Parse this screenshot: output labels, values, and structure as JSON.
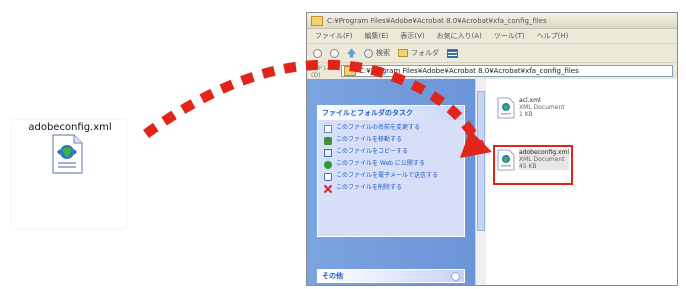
{
  "big_file": {
    "label": "adobeconfig.xml",
    "icon": "xml-file-globe-icon"
  },
  "window": {
    "title": "C:¥Program Files¥Adobe¥Acrobat 8.0¥Acrobat¥xfa_config_files",
    "menu": [
      "ファイル(F)",
      "編集(E)",
      "表示(V)",
      "お気に入り(A)",
      "ツール(T)",
      "ヘルプ(H)"
    ],
    "toolbar": {
      "back_label": "戻る",
      "search_label": "検索",
      "folders_label": "フォルダ"
    },
    "address": {
      "label": "アドレス(D)",
      "value": "C:¥Program Files¥Adobe¥Acrobat 8.0¥Acrobat¥xfa_config_files"
    },
    "task_panel": {
      "header": "ファイルとフォルダのタスク",
      "tasks": [
        {
          "icon": "rename-icon",
          "label": "このファイルの名前を変更する"
        },
        {
          "icon": "move-icon",
          "label": "このファイルを移動する"
        },
        {
          "icon": "copy-icon",
          "label": "このファイルをコピーする"
        },
        {
          "icon": "web-publish-icon",
          "label": "このファイルを Web に公開する"
        },
        {
          "icon": "mail-icon",
          "label": "このファイルを電子メールで送信する"
        },
        {
          "icon": "delete-icon",
          "label": "このファイルを削除する"
        }
      ],
      "other_header": "その他"
    },
    "files": [
      {
        "name": "acl.xml",
        "type": "XML Document",
        "size": "1 KB",
        "selected": false
      },
      {
        "name": "adobeconfig.xml",
        "type": "XML Document",
        "size": "45 KB",
        "selected": true
      }
    ]
  },
  "colors": {
    "arrow": "#e1251b",
    "highlight": "#e1251b",
    "taskpane": "#7ba4e0",
    "link": "#215dc6"
  }
}
